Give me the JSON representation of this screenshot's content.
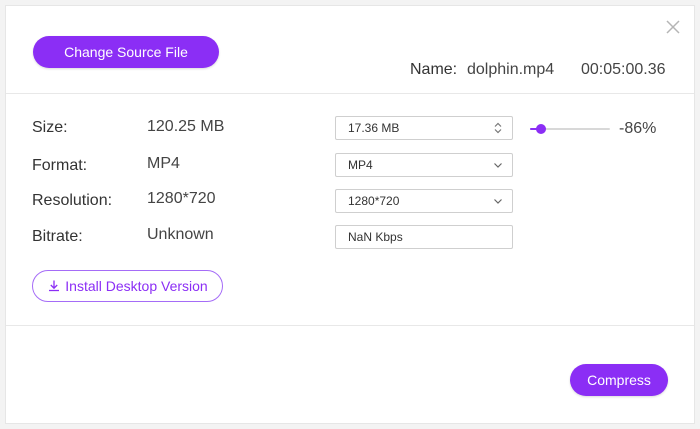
{
  "header": {
    "change_source_label": "Change Source File",
    "name_label": "Name:",
    "file_name": "dolphin.mp4",
    "duration": "00:05:00.36"
  },
  "rows": {
    "size": {
      "label": "Size:",
      "original": "120.25  MB",
      "target": "17.36  MB",
      "compression_percent": "-86%",
      "slider_level_fraction": 0.14
    },
    "format": {
      "label": "Format:",
      "original": "MP4",
      "target": "MP4"
    },
    "resolution": {
      "label": "Resolution:",
      "original": "1280*720",
      "target": "1280*720"
    },
    "bitrate": {
      "label": "Bitrate:",
      "original": "Unknown",
      "target": "NaN Kbps"
    }
  },
  "actions": {
    "install_label": "Install Desktop Version",
    "compress_label": "Compress"
  },
  "icons": {
    "close": "close-icon",
    "spin": "spinner-arrows-icon",
    "dropdown": "chevron-down-icon",
    "download": "download-icon"
  },
  "colors": {
    "accent": "#8b2ef5",
    "border": "#cfcfcf"
  }
}
